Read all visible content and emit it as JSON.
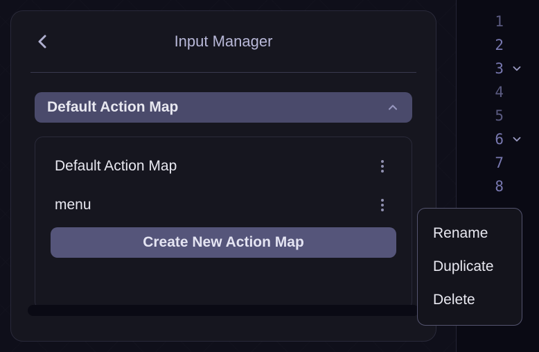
{
  "panel": {
    "title": "Input Manager",
    "dropdown": {
      "selected_label": "Default Action Map",
      "items": [
        {
          "label": "Default Action Map"
        },
        {
          "label": "menu"
        }
      ],
      "create_label": "Create New Action Map"
    }
  },
  "context_menu": {
    "items": [
      {
        "label": "Rename"
      },
      {
        "label": "Duplicate"
      },
      {
        "label": "Delete"
      }
    ]
  },
  "editor": {
    "line_numbers": [
      1,
      2,
      3,
      4,
      5,
      6,
      7,
      8
    ],
    "foldable_lines": [
      3,
      6
    ]
  }
}
